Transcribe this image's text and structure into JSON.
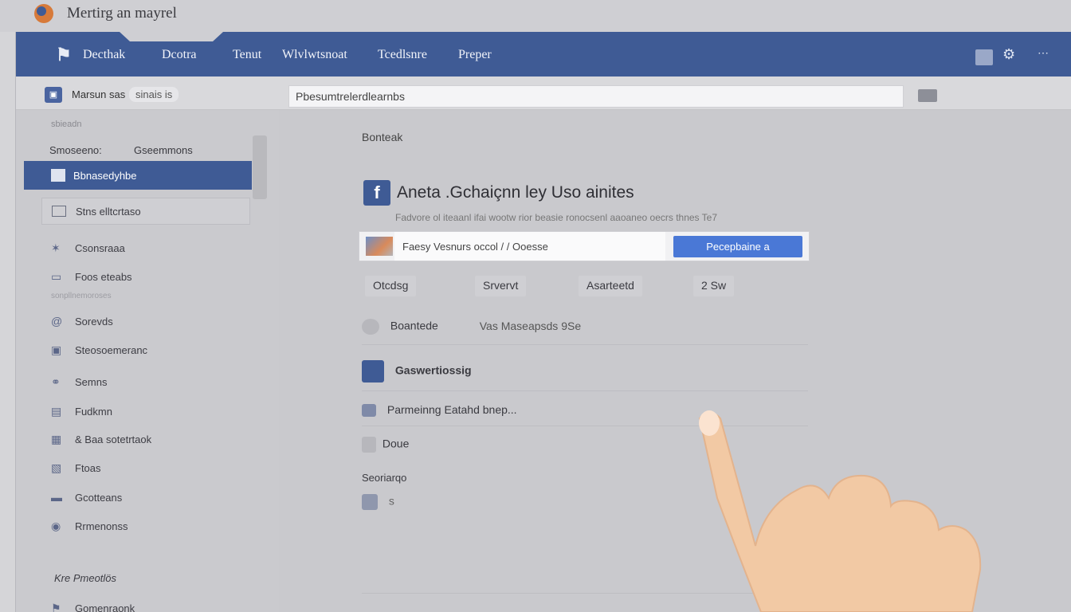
{
  "window": {
    "title": "Mertirg an mayrel"
  },
  "nav": {
    "items": [
      "Decthak",
      "Dcotra",
      "Tenut",
      "Wlvlwtsnoat",
      "Tcedlsnre",
      "Preper"
    ]
  },
  "subbar": {
    "label": "Marsun sas",
    "badge": "sinais is",
    "address_value": "Pbesumtrelerdlearnbs"
  },
  "sidebar": {
    "small_label": "sbieadn",
    "header_left": "Smoseeno:",
    "header_right": "Gseemmons",
    "active_item": "Bbnasedyhbe",
    "boxed_item": "Stns elltcrtaso",
    "items": [
      {
        "icon": "star-icon",
        "label": "Csonsraaa"
      },
      {
        "icon": "list-icon",
        "label": "Foos eteabs"
      },
      {
        "icon": "at-icon",
        "label": "Sorevds"
      },
      {
        "icon": "square-icon",
        "label": "Steosoemeranc"
      },
      {
        "icon": "link-icon",
        "label": "Semns"
      },
      {
        "icon": "image-icon",
        "label": "Fudkmn"
      },
      {
        "icon": "grid-icon",
        "label": "& Baa sotetrtaok"
      },
      {
        "icon": "photo-icon",
        "label": "Ftoas"
      },
      {
        "icon": "card-icon",
        "label": "Gcotteans"
      },
      {
        "icon": "globe-icon",
        "label": "Rrmenonss"
      }
    ],
    "separator": "sonpllnemoroses",
    "footer_label": "Kre Pmeotlös",
    "footer_item": "Gomenraonk"
  },
  "main": {
    "breadcrumb": "Bonteak",
    "title": "Aneta .Gchaiçnn ley  Uso ainites",
    "description": "Fadvore ol iteaanl ifai wootw rior beasie ronocsenl aaoaneo oecrs thnes  Te7",
    "search_value": "Faesy Vesnurs occol / / Ooesse",
    "search_button": "Pecepbaine a",
    "pills": [
      "Otcdsg",
      "Srvervt",
      "Asarteetd",
      "2 Sw"
    ],
    "rows": [
      {
        "label": "Boantede",
        "extra": "Vas Maseapsds 9Se"
      },
      {
        "label": "Gaswertiossig"
      },
      {
        "label": "Parmeinng Eatahd bnep..."
      },
      {
        "label": "Doue"
      }
    ],
    "section_label": "Seoriarqo",
    "last_row_value": "s"
  },
  "colors": {
    "brand": "#3f5b95",
    "accent_button": "#4a78d6",
    "background": "#c9c9cd"
  }
}
